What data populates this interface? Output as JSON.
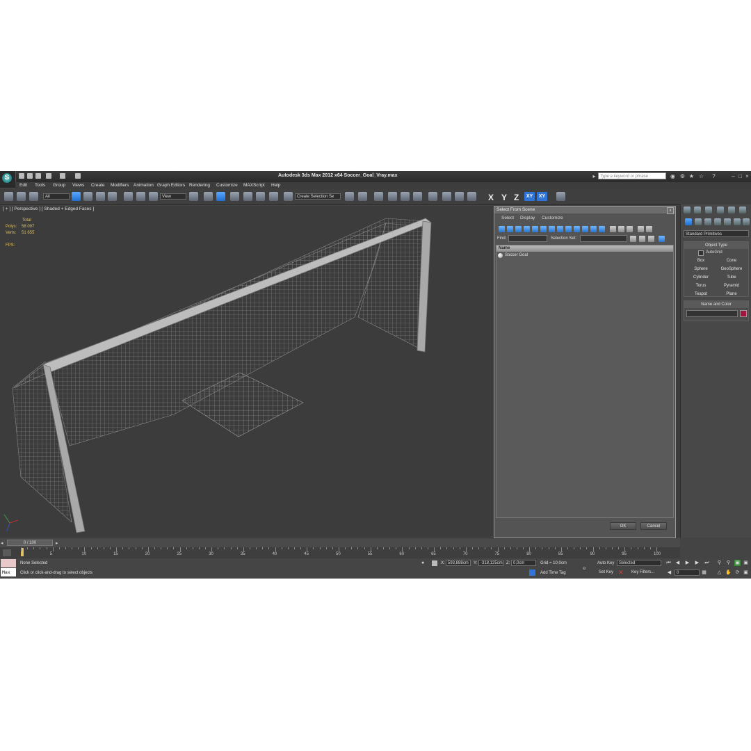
{
  "window": {
    "title": "Autodesk 3ds Max  2012 x64     Soccer_Goal_Vray.max",
    "search_placeholder": "Type a keyword or phrase"
  },
  "menu": [
    "Edit",
    "Tools",
    "Group",
    "Views",
    "Create",
    "Modifiers",
    "Animation",
    "Graph Editors",
    "Rendering",
    "Customize",
    "MAXScript",
    "Help"
  ],
  "toolbar": {
    "filter_value": "All",
    "refcoord_value": "View",
    "selection_set_value": "Create Selection Se",
    "axis_x": "X",
    "axis_y": "Y",
    "axis_z": "Z",
    "axis_xy": "XY",
    "axis_xy2": "XY"
  },
  "viewport": {
    "label": "[ + ] [ Perspective ] [ Shaded + Edged Faces ]",
    "stats": {
      "total_label": "Total",
      "polys_label": "Polys:",
      "polys_value": "58 097",
      "verts_label": "Verts:",
      "verts_value": "51 655",
      "fps_label": "FPS:"
    }
  },
  "dialog": {
    "title": "Select From Scene",
    "close": "x",
    "menu": [
      "Select",
      "Display",
      "Customize"
    ],
    "find_label": "Find:",
    "selection_set_label": "Selection Set:",
    "column_name": "Name",
    "items": [
      "Soccer Goal"
    ],
    "ok": "OK",
    "cancel": "Cancel"
  },
  "command_panel": {
    "dropdown": "Standard Primitives",
    "object_type_title": "Object Type",
    "autogrid": "AutoGrid",
    "buttons": [
      "Box",
      "Cone",
      "Sphere",
      "GeoSphere",
      "Cylinder",
      "Tube",
      "Torus",
      "Pyramid",
      "Teapot",
      "Plane"
    ],
    "name_color_title": "Name and Color",
    "swatch_color": "#a0163c"
  },
  "timeline": {
    "slider": "0 / 100",
    "ticks": [
      "0",
      "5",
      "10",
      "15",
      "20",
      "25",
      "30",
      "35",
      "40",
      "45",
      "50",
      "55",
      "60",
      "65",
      "70",
      "75",
      "80",
      "85",
      "90",
      "95",
      "100"
    ]
  },
  "status": {
    "maxscript": "Max",
    "selection": "None Selected",
    "prompt": "Click or click-and-drag to select objects",
    "x_label": "X:",
    "x_value": "593,888cm",
    "y_label": "Y:",
    "y_value": "-318,125cm",
    "z_label": "Z:",
    "z_value": "0,0cm",
    "grid": "Grid = 10,0cm",
    "add_time_tag": "Add Time Tag",
    "auto_key": "Auto Key",
    "selected": "Selected",
    "set_key": "Set Key",
    "key_filters": "Key Filters...",
    "frame": "0"
  }
}
